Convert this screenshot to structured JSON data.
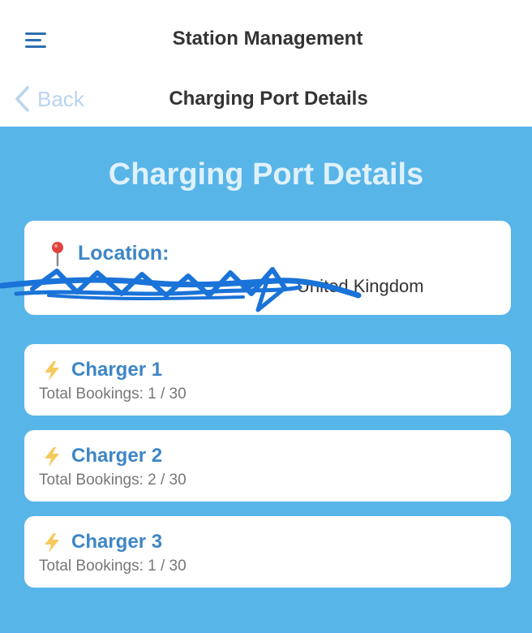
{
  "header": {
    "title": "Station Management",
    "menu_icon": "hamburger-menu-icon"
  },
  "nav": {
    "back_label": "Back",
    "title": "Charging Port Details"
  },
  "page": {
    "title": "Charging Port Details",
    "location": {
      "label": "Location:",
      "value_visible": "United Kingdom",
      "icon": "map-pin-icon"
    },
    "chargers": [
      {
        "name": "Charger 1",
        "bookings_text": "Total Bookings: 1 / 30",
        "icon": "lightning-bolt-icon"
      },
      {
        "name": "Charger 2",
        "bookings_text": "Total Bookings: 2 / 30",
        "icon": "lightning-bolt-icon"
      },
      {
        "name": "Charger 3",
        "bookings_text": "Total Bookings: 1 / 30",
        "icon": "lightning-bolt-icon"
      }
    ]
  },
  "colors": {
    "background_main": "#58b5e8",
    "accent": "#3d86c6",
    "scribble": "#1a73d8",
    "card": "#ffffff"
  }
}
